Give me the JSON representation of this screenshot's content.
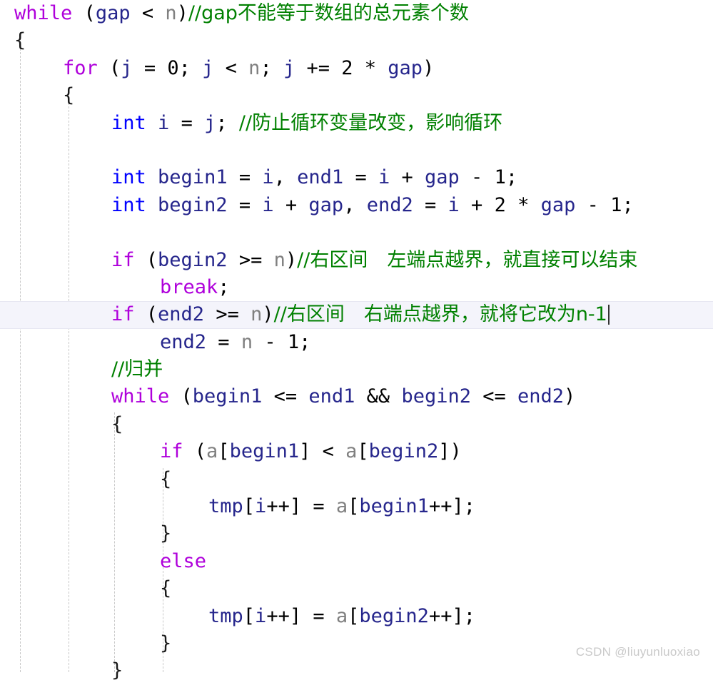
{
  "editor": {
    "language": "c",
    "background": "#ffffff",
    "active_line_index": 11,
    "active_line_highlight_color": "#f4f4fb",
    "caret_visible": true,
    "indent_guide_color": "#c8c8c8",
    "indent_guides_x": [
      28,
      96,
      160,
      228
    ],
    "colors": {
      "keyword": "#af00db",
      "type": "#0000ff",
      "identifier": "#26268c",
      "extern_identifier": "#808080",
      "comment": "#008000",
      "punctuation": "#000000",
      "watermark": "#c9c9c9"
    }
  },
  "lines": [
    {
      "indent": 0,
      "tokens": [
        {
          "t": "while",
          "c": "kw"
        },
        {
          "t": " ",
          "c": "punct"
        },
        {
          "t": "(",
          "c": "punct"
        },
        {
          "t": "gap",
          "c": "ident"
        },
        {
          "t": " < ",
          "c": "punct"
        },
        {
          "t": "n",
          "c": "extern"
        },
        {
          "t": ")",
          "c": "punct"
        },
        {
          "t": "//gap不能等于数组的总元素个数",
          "c": "cmt"
        }
      ]
    },
    {
      "indent": 0,
      "tokens": [
        {
          "t": "{",
          "c": "brace"
        }
      ]
    },
    {
      "indent": 1,
      "tokens": [
        {
          "t": "for",
          "c": "kw"
        },
        {
          "t": " (",
          "c": "punct"
        },
        {
          "t": "j",
          "c": "ident"
        },
        {
          "t": " = ",
          "c": "punct"
        },
        {
          "t": "0",
          "c": "num"
        },
        {
          "t": "; ",
          "c": "punct"
        },
        {
          "t": "j",
          "c": "ident"
        },
        {
          "t": " < ",
          "c": "punct"
        },
        {
          "t": "n",
          "c": "extern"
        },
        {
          "t": "; ",
          "c": "punct"
        },
        {
          "t": "j",
          "c": "ident"
        },
        {
          "t": " += ",
          "c": "punct"
        },
        {
          "t": "2",
          "c": "num"
        },
        {
          "t": " * ",
          "c": "punct"
        },
        {
          "t": "gap",
          "c": "ident"
        },
        {
          "t": ")",
          "c": "punct"
        }
      ]
    },
    {
      "indent": 1,
      "tokens": [
        {
          "t": "{",
          "c": "brace"
        }
      ]
    },
    {
      "indent": 2,
      "tokens": [
        {
          "t": "int",
          "c": "type"
        },
        {
          "t": " ",
          "c": "punct"
        },
        {
          "t": "i",
          "c": "ident"
        },
        {
          "t": " = ",
          "c": "punct"
        },
        {
          "t": "j",
          "c": "ident"
        },
        {
          "t": "; ",
          "c": "punct"
        },
        {
          "t": "//防止循环变量改变，影响循环",
          "c": "cmt"
        }
      ]
    },
    {
      "indent": 0,
      "tokens": []
    },
    {
      "indent": 2,
      "tokens": [
        {
          "t": "int",
          "c": "type"
        },
        {
          "t": " ",
          "c": "punct"
        },
        {
          "t": "begin1",
          "c": "ident"
        },
        {
          "t": " = ",
          "c": "punct"
        },
        {
          "t": "i",
          "c": "ident"
        },
        {
          "t": ", ",
          "c": "punct"
        },
        {
          "t": "end1",
          "c": "ident"
        },
        {
          "t": " = ",
          "c": "punct"
        },
        {
          "t": "i",
          "c": "ident"
        },
        {
          "t": " + ",
          "c": "punct"
        },
        {
          "t": "gap",
          "c": "ident"
        },
        {
          "t": " - ",
          "c": "punct"
        },
        {
          "t": "1",
          "c": "num"
        },
        {
          "t": ";",
          "c": "punct"
        }
      ]
    },
    {
      "indent": 2,
      "tokens": [
        {
          "t": "int",
          "c": "type"
        },
        {
          "t": " ",
          "c": "punct"
        },
        {
          "t": "begin2",
          "c": "ident"
        },
        {
          "t": " = ",
          "c": "punct"
        },
        {
          "t": "i",
          "c": "ident"
        },
        {
          "t": " + ",
          "c": "punct"
        },
        {
          "t": "gap",
          "c": "ident"
        },
        {
          "t": ", ",
          "c": "punct"
        },
        {
          "t": "end2",
          "c": "ident"
        },
        {
          "t": " = ",
          "c": "punct"
        },
        {
          "t": "i",
          "c": "ident"
        },
        {
          "t": " + ",
          "c": "punct"
        },
        {
          "t": "2",
          "c": "num"
        },
        {
          "t": " * ",
          "c": "punct"
        },
        {
          "t": "gap",
          "c": "ident"
        },
        {
          "t": " - ",
          "c": "punct"
        },
        {
          "t": "1",
          "c": "num"
        },
        {
          "t": ";",
          "c": "punct"
        }
      ]
    },
    {
      "indent": 0,
      "tokens": []
    },
    {
      "indent": 2,
      "tokens": [
        {
          "t": "if",
          "c": "kw"
        },
        {
          "t": " (",
          "c": "punct"
        },
        {
          "t": "begin2",
          "c": "ident"
        },
        {
          "t": " >= ",
          "c": "punct"
        },
        {
          "t": "n",
          "c": "extern"
        },
        {
          "t": ")",
          "c": "punct"
        },
        {
          "t": "//右区间　左端点越界，就直接可以结束",
          "c": "cmt"
        }
      ]
    },
    {
      "indent": 3,
      "tokens": [
        {
          "t": "break",
          "c": "kw"
        },
        {
          "t": ";",
          "c": "punct"
        }
      ]
    },
    {
      "indent": 2,
      "active": true,
      "tokens": [
        {
          "t": "if",
          "c": "kw"
        },
        {
          "t": " (",
          "c": "punct"
        },
        {
          "t": "end2",
          "c": "ident"
        },
        {
          "t": " >= ",
          "c": "punct"
        },
        {
          "t": "n",
          "c": "extern"
        },
        {
          "t": ")",
          "c": "punct"
        },
        {
          "t": "//右区间　右端点越界，就将它改为n-1",
          "c": "cmt"
        }
      ]
    },
    {
      "indent": 3,
      "tokens": [
        {
          "t": "end2",
          "c": "ident"
        },
        {
          "t": " = ",
          "c": "punct"
        },
        {
          "t": "n",
          "c": "extern"
        },
        {
          "t": " - ",
          "c": "punct"
        },
        {
          "t": "1",
          "c": "num"
        },
        {
          "t": ";",
          "c": "punct"
        }
      ]
    },
    {
      "indent": 2,
      "tokens": [
        {
          "t": "//归并",
          "c": "cmt"
        }
      ]
    },
    {
      "indent": 2,
      "tokens": [
        {
          "t": "while",
          "c": "kw"
        },
        {
          "t": " (",
          "c": "punct"
        },
        {
          "t": "begin1",
          "c": "ident"
        },
        {
          "t": " <= ",
          "c": "punct"
        },
        {
          "t": "end1",
          "c": "ident"
        },
        {
          "t": " && ",
          "c": "punct"
        },
        {
          "t": "begin2",
          "c": "ident"
        },
        {
          "t": " <= ",
          "c": "punct"
        },
        {
          "t": "end2",
          "c": "ident"
        },
        {
          "t": ")",
          "c": "punct"
        }
      ]
    },
    {
      "indent": 2,
      "tokens": [
        {
          "t": "{",
          "c": "brace"
        }
      ]
    },
    {
      "indent": 3,
      "tokens": [
        {
          "t": "if",
          "c": "kw"
        },
        {
          "t": " (",
          "c": "punct"
        },
        {
          "t": "a",
          "c": "extern"
        },
        {
          "t": "[",
          "c": "punct"
        },
        {
          "t": "begin1",
          "c": "ident"
        },
        {
          "t": "] < ",
          "c": "punct"
        },
        {
          "t": "a",
          "c": "extern"
        },
        {
          "t": "[",
          "c": "punct"
        },
        {
          "t": "begin2",
          "c": "ident"
        },
        {
          "t": "])",
          "c": "punct"
        }
      ]
    },
    {
      "indent": 3,
      "tokens": [
        {
          "t": "{",
          "c": "brace"
        }
      ]
    },
    {
      "indent": 4,
      "tokens": [
        {
          "t": "tmp",
          "c": "ident"
        },
        {
          "t": "[",
          "c": "punct"
        },
        {
          "t": "i",
          "c": "ident"
        },
        {
          "t": "++] = ",
          "c": "punct"
        },
        {
          "t": "a",
          "c": "extern"
        },
        {
          "t": "[",
          "c": "punct"
        },
        {
          "t": "begin1",
          "c": "ident"
        },
        {
          "t": "++];",
          "c": "punct"
        }
      ]
    },
    {
      "indent": 3,
      "tokens": [
        {
          "t": "}",
          "c": "brace"
        }
      ]
    },
    {
      "indent": 3,
      "tokens": [
        {
          "t": "else",
          "c": "kw"
        }
      ]
    },
    {
      "indent": 3,
      "tokens": [
        {
          "t": "{",
          "c": "brace"
        }
      ]
    },
    {
      "indent": 4,
      "tokens": [
        {
          "t": "tmp",
          "c": "ident"
        },
        {
          "t": "[",
          "c": "punct"
        },
        {
          "t": "i",
          "c": "ident"
        },
        {
          "t": "++] = ",
          "c": "punct"
        },
        {
          "t": "a",
          "c": "extern"
        },
        {
          "t": "[",
          "c": "punct"
        },
        {
          "t": "begin2",
          "c": "ident"
        },
        {
          "t": "++];",
          "c": "punct"
        }
      ]
    },
    {
      "indent": 3,
      "tokens": [
        {
          "t": "}",
          "c": "brace"
        }
      ]
    },
    {
      "indent": 2,
      "tokens": [
        {
          "t": "}",
          "c": "brace"
        }
      ]
    }
  ],
  "watermark": {
    "text": "CSDN @liuyunluoxiao"
  }
}
